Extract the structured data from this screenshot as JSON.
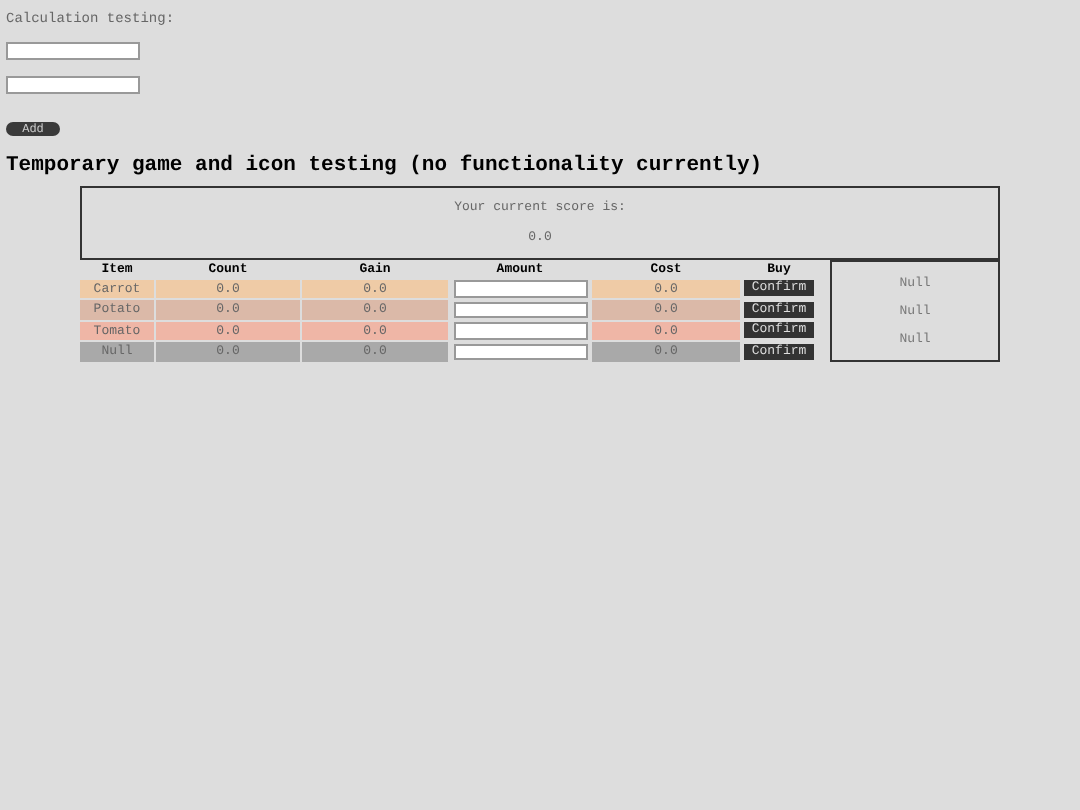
{
  "calculation": {
    "label": "Calculation testing:",
    "button": "Add"
  },
  "heading": "Temporary game and icon testing (no functionality currently)",
  "score": {
    "label": "Your current score is:",
    "value": "0.0"
  },
  "table": {
    "columns": [
      "Item",
      "Count",
      "Gain",
      "Amount",
      "Cost",
      "Buy"
    ],
    "rows": [
      {
        "item": "Carrot",
        "count": "0.0",
        "gain": "0.0",
        "cost": "0.0",
        "button": "Confirm",
        "color": "#efcba6"
      },
      {
        "item": "Potato",
        "count": "0.0",
        "gain": "0.0",
        "cost": "0.0",
        "button": "Confirm",
        "color": "#dbb9a8"
      },
      {
        "item": "Tomato",
        "count": "0.0",
        "gain": "0.0",
        "cost": "0.0",
        "button": "Confirm",
        "color": "#efb6a6"
      },
      {
        "item": "Null",
        "count": "0.0",
        "gain": "0.0",
        "cost": "0.0",
        "button": "Confirm",
        "color": "#a9a9a9"
      }
    ]
  },
  "side_panel": [
    "Null",
    "Null",
    "Null"
  ]
}
